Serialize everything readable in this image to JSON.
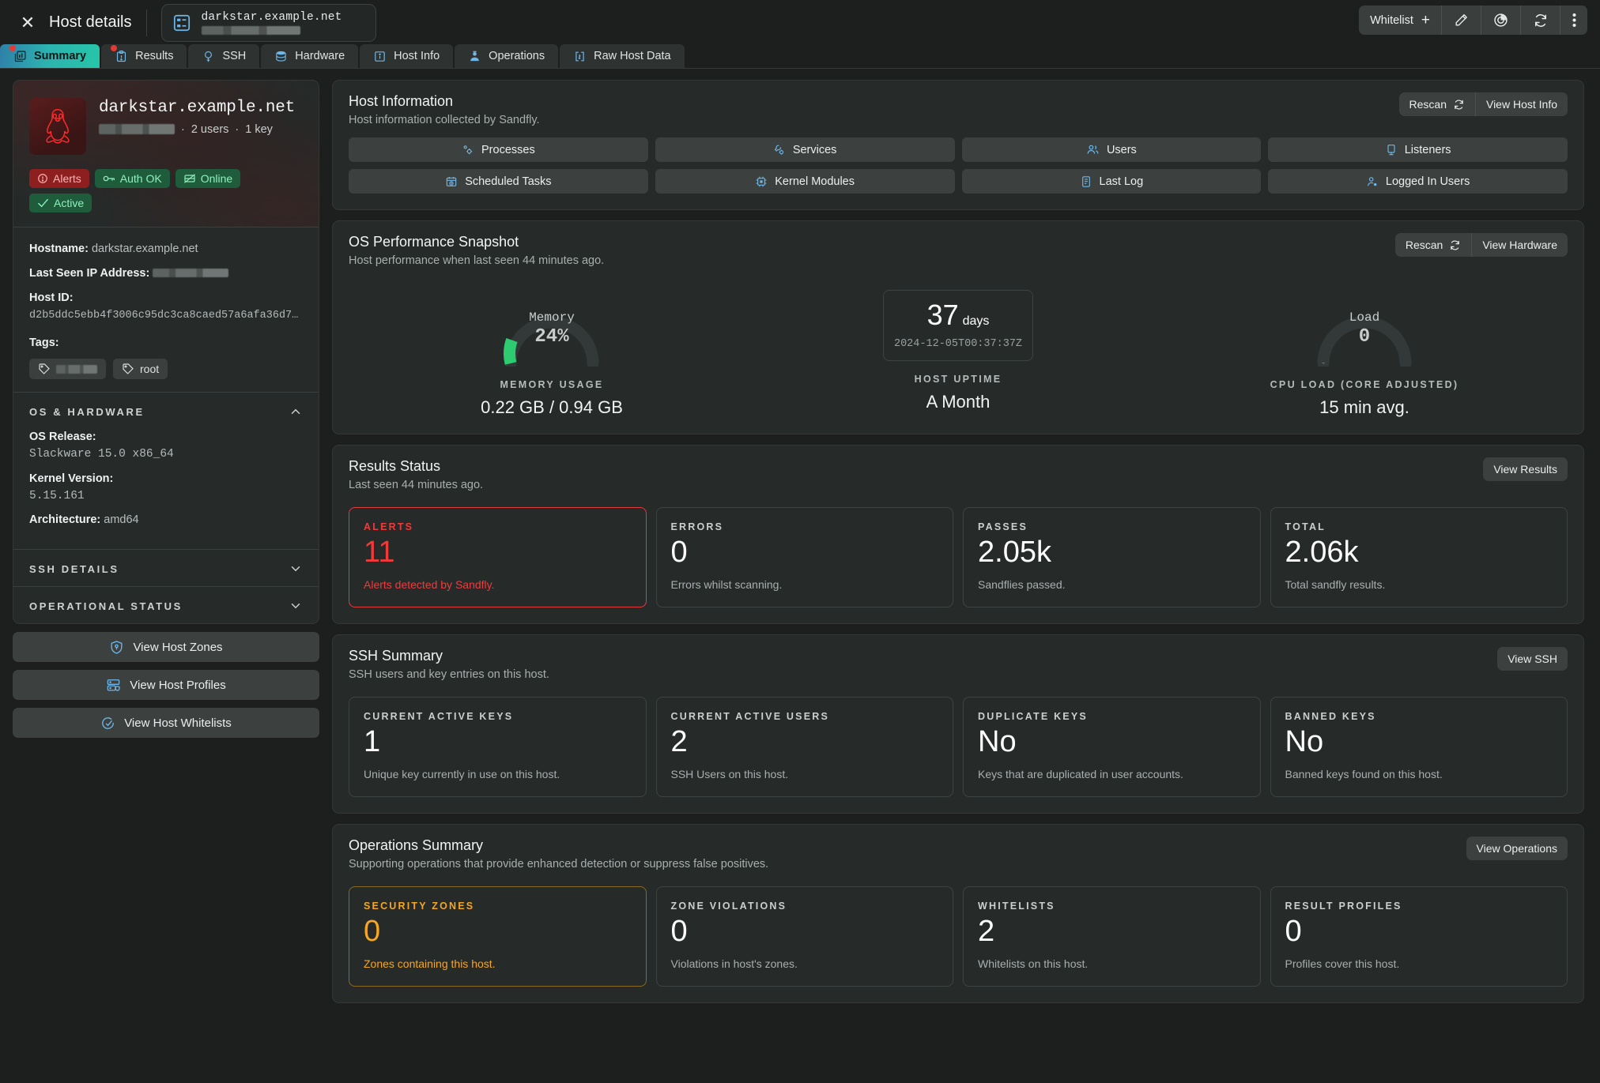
{
  "topbar": {
    "title": "Host details",
    "close_icon": "close-x-icon",
    "host_chip": {
      "icon": "server-icon",
      "name": "darkstar.example.net",
      "subtitle_redacted": true
    },
    "whitelist_label": "Whitelist",
    "whitelist_plus": "+",
    "edit_icon": "pencil-icon",
    "target_icon": "target-scan-icon",
    "refresh_icon": "refresh-icon",
    "more_icon": "kebab-menu-icon"
  },
  "tabs": [
    {
      "label": "Summary",
      "icon": "chart-stack-icon",
      "active": true,
      "dot": true
    },
    {
      "label": "Results",
      "icon": "clipboard-icon",
      "active": false,
      "dot": true
    },
    {
      "label": "SSH",
      "icon": "ssh-key-icon",
      "active": false,
      "dot": false
    },
    {
      "label": "Hardware",
      "icon": "database-icon",
      "active": false,
      "dot": false
    },
    {
      "label": "Host Info",
      "icon": "info-icon",
      "active": false,
      "dot": false
    },
    {
      "label": "Operations",
      "icon": "operations-icon",
      "active": false,
      "dot": false
    },
    {
      "label": "Raw Host Data",
      "icon": "code-brackets-icon",
      "active": false,
      "dot": false
    }
  ],
  "sidebar": {
    "host_name": "darkstar.example.net",
    "os_icon": "linux-tux-icon",
    "meta_sep1": "·",
    "meta_users": "2 users",
    "meta_sep2": "·",
    "meta_keys": "1 key",
    "status_chips": [
      {
        "label": "Alerts",
        "icon": "alert-circle-icon",
        "tone": "red"
      },
      {
        "label": "Auth OK",
        "icon": "key-icon",
        "tone": "green"
      },
      {
        "label": "Online",
        "icon": "network-icon",
        "tone": "green"
      },
      {
        "label": "Active",
        "icon": "check-icon",
        "tone": "green"
      }
    ],
    "fields": {
      "hostname_label": "Hostname:",
      "hostname_value": "darkstar.example.net",
      "ip_label": "Last Seen IP Address:",
      "ip_value_redacted": true,
      "hostid_label": "Host ID:",
      "hostid_value": "d2b5ddc5ebb4f3006c95dc3ca8caed57a6afa36d7…",
      "tags_label": "Tags:"
    },
    "tags": [
      {
        "label": "",
        "redacted": true,
        "icon": "tag-icon"
      },
      {
        "label": "root",
        "redacted": false,
        "icon": "tag-icon"
      }
    ],
    "accordions": [
      {
        "title": "OS & HARDWARE",
        "expanded": true,
        "chevron": "chevron-up-icon",
        "rows": [
          {
            "label": "OS Release:",
            "value": "Slackware 15.0 x86_64",
            "stacked": true
          },
          {
            "label": "Kernel Version:",
            "value": "5.15.161",
            "stacked": true
          },
          {
            "label": "Architecture:",
            "value": "amd64",
            "stacked": false
          }
        ]
      },
      {
        "title": "SSH DETAILS",
        "expanded": false,
        "chevron": "chevron-down-icon",
        "rows": []
      },
      {
        "title": "OPERATIONAL STATUS",
        "expanded": false,
        "chevron": "chevron-down-icon",
        "rows": []
      }
    ],
    "buttons": [
      {
        "label": "View Host Zones",
        "icon": "shield-key-icon"
      },
      {
        "label": "View Host Profiles",
        "icon": "server-profile-icon"
      },
      {
        "label": "View Host Whitelists",
        "icon": "check-circle-icon"
      }
    ]
  },
  "host_information": {
    "title": "Host Information",
    "subtitle": "Host information collected by Sandfly.",
    "rescan_label": "Rescan",
    "rescan_icon": "refresh-icon",
    "view_label": "View Host Info",
    "buttons": [
      {
        "label": "Processes",
        "icon": "gear-process-icon"
      },
      {
        "label": "Services",
        "icon": "wrench-gear-icon"
      },
      {
        "label": "Users",
        "icon": "users-icon"
      },
      {
        "label": "Listeners",
        "icon": "monitor-icon"
      },
      {
        "label": "Scheduled Tasks",
        "icon": "calendar-clock-icon"
      },
      {
        "label": "Kernel Modules",
        "icon": "chip-icon"
      },
      {
        "label": "Last Log",
        "icon": "log-file-icon"
      },
      {
        "label": "Logged In Users",
        "icon": "user-check-icon"
      }
    ]
  },
  "os_performance": {
    "title": "OS Performance Snapshot",
    "subtitle": "Host performance when last seen 44 minutes ago.",
    "rescan_label": "Rescan",
    "rescan_icon": "refresh-icon",
    "view_label": "View Hardware",
    "memory": {
      "gauge_caption": "Memory",
      "gauge_value": "24%",
      "percent": 24,
      "caption": "MEMORY USAGE",
      "value": "0.22 GB / 0.94 GB",
      "arc_color": "#2ecc71"
    },
    "uptime": {
      "number": "37",
      "unit": "days",
      "timestamp": "2024-12-05T00:37:37Z",
      "caption": "HOST UPTIME",
      "value": "A Month"
    },
    "load": {
      "gauge_caption": "Load",
      "gauge_value": "0",
      "percent": 0,
      "caption": "CPU LOAD (CORE ADJUSTED)",
      "value": "15 min avg."
    }
  },
  "results_status": {
    "title": "Results Status",
    "subtitle": "Last seen 44 minutes ago.",
    "view_label": "View Results",
    "cards": [
      {
        "label": "ALERTS",
        "value": "11",
        "desc": "Alerts detected by Sandfly.",
        "tone": "alert"
      },
      {
        "label": "ERRORS",
        "value": "0",
        "desc": "Errors whilst scanning.",
        "tone": "normal"
      },
      {
        "label": "PASSES",
        "value": "2.05k",
        "desc": "Sandflies passed.",
        "tone": "normal"
      },
      {
        "label": "TOTAL",
        "value": "2.06k",
        "desc": "Total sandfly results.",
        "tone": "normal"
      }
    ]
  },
  "ssh_summary": {
    "title": "SSH Summary",
    "subtitle": "SSH users and key entries on this host.",
    "view_label": "View SSH",
    "cards": [
      {
        "label": "CURRENT ACTIVE KEYS",
        "value": "1",
        "desc": "Unique key currently in use on this host.",
        "tone": "normal"
      },
      {
        "label": "CURRENT ACTIVE USERS",
        "value": "2",
        "desc": "SSH Users on this host.",
        "tone": "normal"
      },
      {
        "label": "DUPLICATE KEYS",
        "value": "No",
        "desc": "Keys that are duplicated in user accounts.",
        "tone": "normal"
      },
      {
        "label": "BANNED KEYS",
        "value": "No",
        "desc": "Banned keys found on this host.",
        "tone": "normal"
      }
    ]
  },
  "operations_summary": {
    "title": "Operations Summary",
    "subtitle": "Supporting operations that provide enhanced detection or suppress false positives.",
    "view_label": "View Operations",
    "cards": [
      {
        "label": "SECURITY ZONES",
        "value": "0",
        "desc": "Zones containing this host.",
        "tone": "warn"
      },
      {
        "label": "ZONE VIOLATIONS",
        "value": "0",
        "desc": "Violations in host's zones.",
        "tone": "normal"
      },
      {
        "label": "WHITELISTS",
        "value": "2",
        "desc": "Whitelists on this host.",
        "tone": "normal"
      },
      {
        "label": "RESULT PROFILES",
        "value": "0",
        "desc": "Profiles cover this host.",
        "tone": "normal"
      }
    ]
  },
  "colors": {
    "accent_blue": "#6fb7e8",
    "alert_red": "#f03a3a",
    "warn_amber": "#f5a623",
    "green": "#2ecc71",
    "tab_active_from": "#2f7fa8",
    "tab_active_to": "#27c5a8"
  }
}
